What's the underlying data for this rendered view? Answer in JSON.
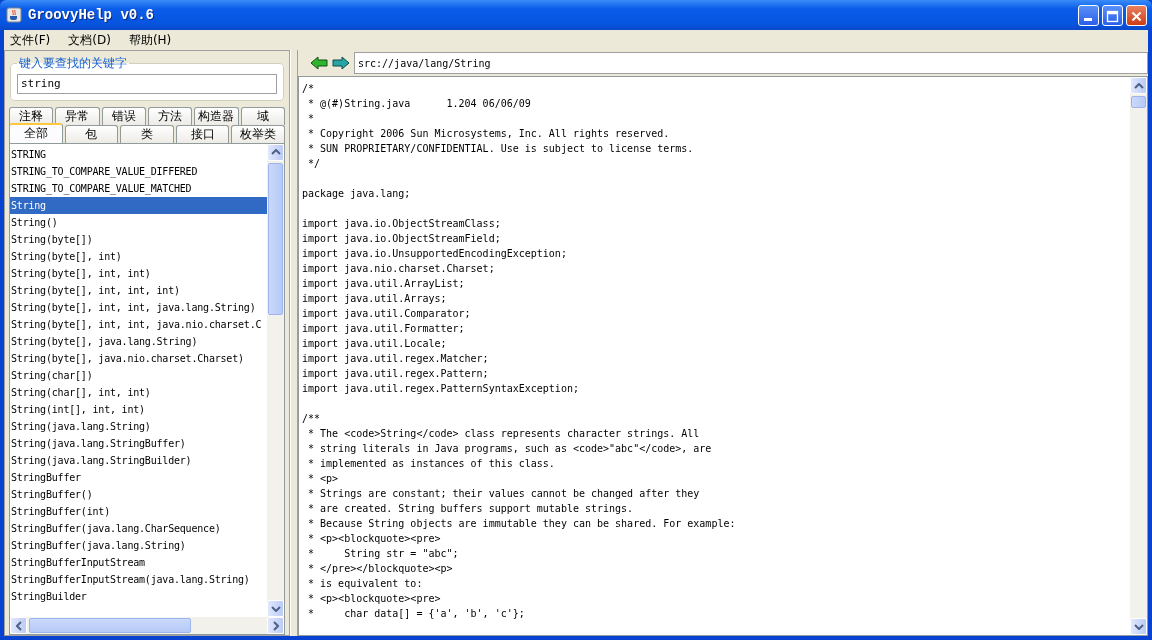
{
  "window": {
    "title": "GroovyHelp v0.6"
  },
  "menu": [
    "文件(F)",
    "文档(D)",
    "帮助(H)"
  ],
  "search": {
    "legend": "键入要查找的关键字",
    "value": "string"
  },
  "tab_rows": [
    [
      {
        "label": "注释",
        "selected": false
      },
      {
        "label": "异常",
        "selected": false
      },
      {
        "label": "错误",
        "selected": false
      },
      {
        "label": "方法",
        "selected": false
      },
      {
        "label": "构造器",
        "selected": false
      },
      {
        "label": "域",
        "selected": false
      }
    ],
    [
      {
        "label": "全部",
        "selected": true
      },
      {
        "label": "包",
        "selected": false
      },
      {
        "label": "类",
        "selected": false
      },
      {
        "label": "接口",
        "selected": false
      },
      {
        "label": "枚举类",
        "selected": false
      }
    ]
  ],
  "results": [
    {
      "label": "STRING",
      "selected": false
    },
    {
      "label": "STRING_TO_COMPARE_VALUE_DIFFERED",
      "selected": false
    },
    {
      "label": "STRING_TO_COMPARE_VALUE_MATCHED",
      "selected": false
    },
    {
      "label": "String",
      "selected": true
    },
    {
      "label": "String()",
      "selected": false
    },
    {
      "label": "String(byte[])",
      "selected": false
    },
    {
      "label": "String(byte[], int)",
      "selected": false
    },
    {
      "label": "String(byte[], int, int)",
      "selected": false
    },
    {
      "label": "String(byte[], int, int, int)",
      "selected": false
    },
    {
      "label": "String(byte[], int, int, java.lang.String)",
      "selected": false
    },
    {
      "label": "String(byte[], int, int, java.nio.charset.C",
      "selected": false
    },
    {
      "label": "String(byte[], java.lang.String)",
      "selected": false
    },
    {
      "label": "String(byte[], java.nio.charset.Charset)",
      "selected": false
    },
    {
      "label": "String(char[])",
      "selected": false
    },
    {
      "label": "String(char[], int, int)",
      "selected": false
    },
    {
      "label": "String(int[], int, int)",
      "selected": false
    },
    {
      "label": "String(java.lang.String)",
      "selected": false
    },
    {
      "label": "String(java.lang.StringBuffer)",
      "selected": false
    },
    {
      "label": "String(java.lang.StringBuilder)",
      "selected": false
    },
    {
      "label": "StringBuffer",
      "selected": false
    },
    {
      "label": "StringBuffer()",
      "selected": false
    },
    {
      "label": "StringBuffer(int)",
      "selected": false
    },
    {
      "label": "StringBuffer(java.lang.CharSequence)",
      "selected": false
    },
    {
      "label": "StringBuffer(java.lang.String)",
      "selected": false
    },
    {
      "label": "StringBufferInputStream",
      "selected": false
    },
    {
      "label": "StringBufferInputStream(java.lang.String)",
      "selected": false
    },
    {
      "label": "StringBuilder",
      "selected": false
    }
  ],
  "address": "src://java/lang/String",
  "source_blocks": [
    [
      "/*",
      " * @(#)String.java\t1.204 06/06/09",
      " *",
      " * Copyright 2006 Sun Microsystems, Inc. All rights reserved.",
      " * SUN PROPRIETARY/CONFIDENTIAL. Use is subject to license terms.",
      " */"
    ],
    [
      "package java.lang;"
    ],
    [
      "import java.io.ObjectStreamClass;",
      "import java.io.ObjectStreamField;",
      "import java.io.UnsupportedEncodingException;",
      "import java.nio.charset.Charset;",
      "import java.util.ArrayList;",
      "import java.util.Arrays;",
      "import java.util.Comparator;",
      "import java.util.Formatter;",
      "import java.util.Locale;",
      "import java.util.regex.Matcher;",
      "import java.util.regex.Pattern;",
      "import java.util.regex.PatternSyntaxException;"
    ],
    [
      "/**",
      " * The <code>String</code> class represents character strings. All",
      " * string literals in Java programs, such as <code>\"abc\"</code>, are",
      " * implemented as instances of this class.",
      " * <p>",
      " * Strings are constant; their values cannot be changed after they",
      " * are created. String buffers support mutable strings.",
      " * Because String objects are immutable they can be shared. For example:",
      " * <p><blockquote><pre>",
      " *     String str = \"abc\";",
      " * </pre></blockquote><p>",
      " * is equivalent to:",
      " * <p><blockquote><pre>",
      " *     char data[] = {'a', 'b', 'c'};"
    ]
  ]
}
